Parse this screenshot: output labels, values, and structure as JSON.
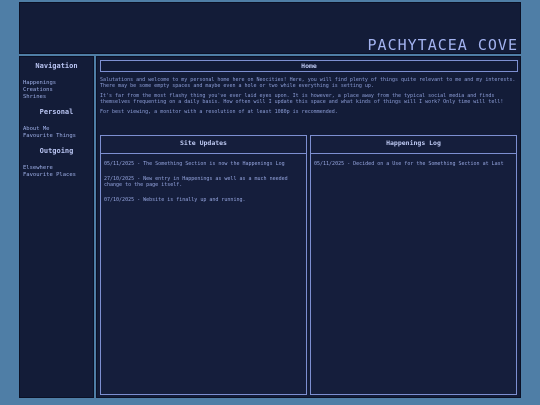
{
  "banner": {
    "title": "PACHYTACEA COVE"
  },
  "sidebar": {
    "sections": [
      {
        "heading": "Navigation",
        "links": [
          "Happenings",
          "Creations",
          "Shrines"
        ]
      },
      {
        "heading": "Personal",
        "links": [
          "About Me",
          "Favourite Things"
        ]
      },
      {
        "heading": "Outgoing",
        "links": [
          "Elsewhere",
          "Favourite Places"
        ]
      }
    ]
  },
  "main": {
    "home_title": "Home",
    "intro": [
      "Salutations and welcome to my personal home here on Neocities! Here, you will find plenty of things quite relevant to me and my interests. There may be some empty spaces and maybe even a hole or two while everything is setting up.",
      "It's far from the most flashy thing you've ever laid eyes upon. It is however, a place away from the typical social media and finds themselves frequenting on a daily basis. How often will I update this space and what kinds of things will I work? Only time will tell!",
      "For best viewing, a monitor with a resolution of at least 1080p is recommended."
    ],
    "site_updates": {
      "title": "Site Updates",
      "entries": [
        "05/11/2025 - The Something Section is now the Happenings Log",
        "27/10/2025 - New entry in Happenings as well as a much needed change to the page itself.",
        "07/10/2025 - Website is finally up and running."
      ]
    },
    "happenings_log": {
      "title": "Happenings Log",
      "entries": [
        "05/11/2025 - Decided on a Use for the Something Section at Last"
      ]
    }
  }
}
